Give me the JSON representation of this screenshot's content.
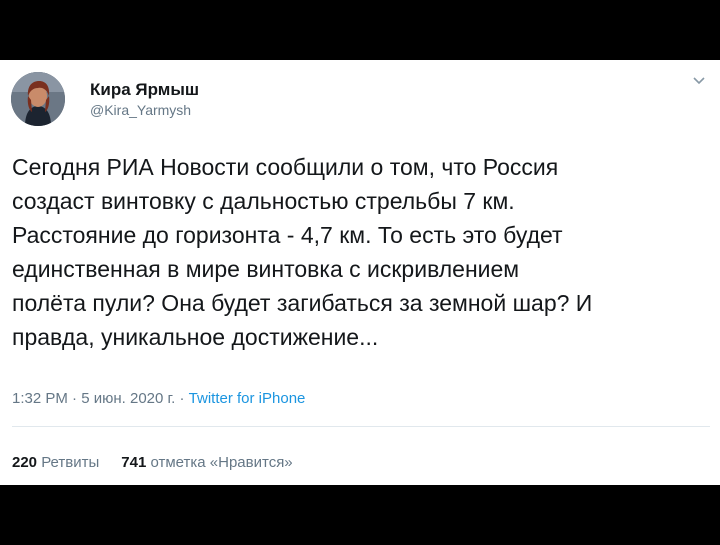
{
  "author": {
    "display_name": "Кира Ярмыш",
    "handle": "@Kira_Yarmysh",
    "avatar_icon": "avatar-photo"
  },
  "menu": {
    "icon": "chevron-down-icon"
  },
  "tweet": {
    "lines": [
      "Сегодня РИА Новости сообщили о том, что Россия",
      "создаст винтовку с дальностью стрельбы 7 км.",
      "Расстояние до горизонта - 4,7 км. То есть это будет",
      "единственная в мире винтовка с искривлением",
      "полёта пули? Она будет загибаться за земной шар? И",
      "правда, уникальное достижение..."
    ]
  },
  "meta": {
    "time": "1:32 PM",
    "separator": " · ",
    "date": "5 июн. 2020 г.",
    "source": "Twitter for iPhone"
  },
  "stats": {
    "retweets_count": "220",
    "retweets_label": "Ретвиты",
    "likes_count": "741",
    "likes_label": "отметка «Нравится»"
  },
  "colors": {
    "text": "#14171a",
    "secondary": "#657786",
    "link": "#1b95e0",
    "frame": "#000000"
  }
}
